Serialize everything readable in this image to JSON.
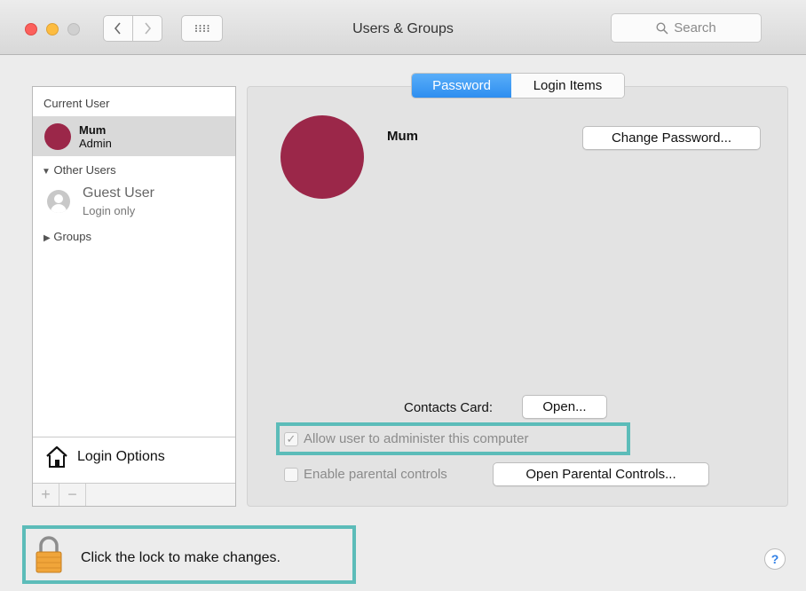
{
  "window": {
    "title": "Users & Groups",
    "search_placeholder": "Search",
    "nav_back_icon": "chevron-left-icon",
    "nav_forward_icon": "chevron-right-icon",
    "grid_icon": "show-all-grid-icon"
  },
  "sidebar": {
    "current_user_header": "Current User",
    "current_user": {
      "name": "Mum",
      "role": "Admin",
      "avatar_color": "#9b2749"
    },
    "other_users_header": "Other Users",
    "guest": {
      "name": "Guest User",
      "role": "Login only"
    },
    "groups_label": "Groups",
    "login_options_label": "Login Options",
    "add_label": "+",
    "remove_label": "−"
  },
  "tabs": [
    {
      "label": "Password",
      "active": true
    },
    {
      "label": "Login Items",
      "active": false
    }
  ],
  "user": {
    "name": "Mum",
    "avatar_color": "#9b2749"
  },
  "buttons": {
    "change_password": "Change Password...",
    "open_contacts": "Open...",
    "open_parental": "Open Parental Controls..."
  },
  "contacts_card_label": "Contacts Card:",
  "checkboxes": {
    "admin": {
      "label": "Allow user to administer this computer",
      "checked": true,
      "enabled": false
    },
    "parental": {
      "label": "Enable parental controls",
      "checked": false,
      "enabled": false
    }
  },
  "lock": {
    "text": "Click the lock to make changes.",
    "icon": "padlock-icon"
  },
  "help_label": "?",
  "colors": {
    "accent": "#2e8ef0",
    "highlight": "#5cbcb9"
  }
}
